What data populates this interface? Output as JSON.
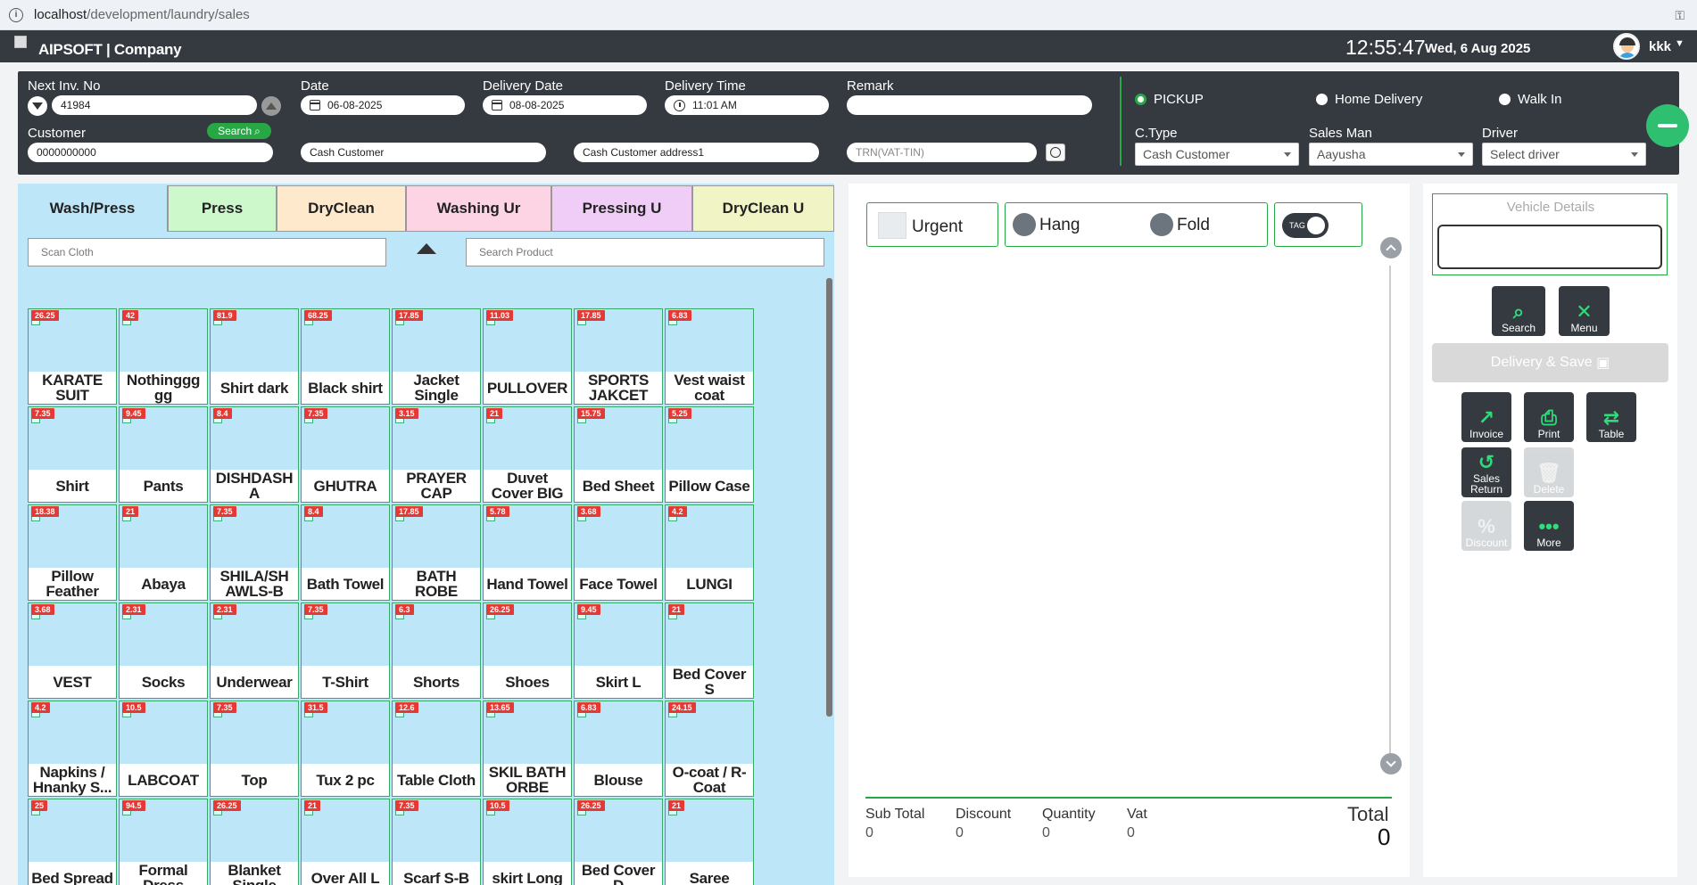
{
  "browser": {
    "url_host": "localhost",
    "url_path": "/development/laundry/sales"
  },
  "header": {
    "brand": "AIPSOFT | Company",
    "time": "12:55:47",
    "date": "Wed, 6 Aug 2025",
    "user": "kkk"
  },
  "form": {
    "next_inv_label": "Next Inv. No",
    "next_inv_value": "41984",
    "date_label": "Date",
    "date_value": "06-08-2025",
    "delivery_date_label": "Delivery Date",
    "delivery_date_value": "08-08-2025",
    "delivery_time_label": "Delivery Time",
    "delivery_time_value": "11:01 AM",
    "remark_label": "Remark",
    "remark_value": "",
    "customer_label": "Customer",
    "customer_search": "Search",
    "customer_phone": "0000000000",
    "customer_name": "Cash Customer",
    "customer_address": "Cash Customer address1",
    "trn_placeholder": "TRN(VAT-TIN)",
    "radio_pickup": "PICKUP",
    "radio_home": "Home Delivery",
    "radio_walkin": "Walk In",
    "ctype_label": "C.Type",
    "ctype_value": "Cash Customer",
    "salesman_label": "Sales Man",
    "salesman_value": "Aayusha",
    "driver_label": "Driver",
    "driver_value": "Select driver"
  },
  "tabs": [
    {
      "label": "Wash/Press",
      "color": "#bde6f8"
    },
    {
      "label": "Press",
      "color": "#cdf8cc"
    },
    {
      "label": "DryClean",
      "color": "#ffe9cc"
    },
    {
      "label": "Washing Ur",
      "color": "#fcd4e4"
    },
    {
      "label": "Pressing U",
      "color": "#efcdf7"
    },
    {
      "label": "DryClean U",
      "color": "#f1f4c4"
    }
  ],
  "search": {
    "scan_placeholder": "Scan Cloth",
    "product_placeholder": "Search Product"
  },
  "products": [
    {
      "price": "26.25",
      "name": "KARATE SUIT"
    },
    {
      "price": "42",
      "name": "Nothinggg gg"
    },
    {
      "price": "81.9",
      "name": "Shirt dark"
    },
    {
      "price": "68.25",
      "name": "Black shirt"
    },
    {
      "price": "17.85",
      "name": "Jacket Single"
    },
    {
      "price": "11.03",
      "name": "PULLOVER"
    },
    {
      "price": "17.85",
      "name": "SPORTS JAKCET"
    },
    {
      "price": "6.83",
      "name": "Vest waist coat"
    },
    {
      "price": "7.35",
      "name": "Shirt"
    },
    {
      "price": "9.45",
      "name": "Pants"
    },
    {
      "price": "8.4",
      "name": "DISHDASH A"
    },
    {
      "price": "7.35",
      "name": "GHUTRA"
    },
    {
      "price": "3.15",
      "name": "PRAYER CAP"
    },
    {
      "price": "21",
      "name": "Duvet Cover BIG"
    },
    {
      "price": "15.75",
      "name": "Bed Sheet"
    },
    {
      "price": "5.25",
      "name": "Pillow Case"
    },
    {
      "price": "18.38",
      "name": "Pillow Feather"
    },
    {
      "price": "21",
      "name": "Abaya"
    },
    {
      "price": "7.35",
      "name": "SHILA/SH AWLS-B"
    },
    {
      "price": "8.4",
      "name": "Bath Towel"
    },
    {
      "price": "17.85",
      "name": "BATH ROBE"
    },
    {
      "price": "5.78",
      "name": "Hand Towel"
    },
    {
      "price": "3.68",
      "name": "Face Towel"
    },
    {
      "price": "4.2",
      "name": "LUNGI"
    },
    {
      "price": "3.68",
      "name": "VEST"
    },
    {
      "price": "2.31",
      "name": "Socks"
    },
    {
      "price": "2.31",
      "name": "Underwear"
    },
    {
      "price": "7.35",
      "name": "T-Shirt"
    },
    {
      "price": "6.3",
      "name": "Shorts"
    },
    {
      "price": "26.25",
      "name": "Shoes"
    },
    {
      "price": "9.45",
      "name": "Skirt L"
    },
    {
      "price": "21",
      "name": "Bed Cover S"
    },
    {
      "price": "4.2",
      "name": "Napkins / Hnanky S..."
    },
    {
      "price": "10.5",
      "name": "LABCOAT"
    },
    {
      "price": "7.35",
      "name": "Top"
    },
    {
      "price": "31.5",
      "name": "Tux 2 pc"
    },
    {
      "price": "12.6",
      "name": "Table Cloth"
    },
    {
      "price": "13.65",
      "name": "SKIL BATH ORBE"
    },
    {
      "price": "6.83",
      "name": "Blouse"
    },
    {
      "price": "24.15",
      "name": "O-coat / R-Coat"
    },
    {
      "price": "25",
      "name": "Bed Spread"
    },
    {
      "price": "94.5",
      "name": "Formal Dress"
    },
    {
      "price": "26.25",
      "name": "Blanket Single"
    },
    {
      "price": "21",
      "name": "Over All L"
    },
    {
      "price": "7.35",
      "name": "Scarf S-B"
    },
    {
      "price": "10.5",
      "name": "skirt Long"
    },
    {
      "price": "26.25",
      "name": "Bed Cover D"
    },
    {
      "price": "21",
      "name": "Saree"
    }
  ],
  "options": {
    "urgent": "Urgent",
    "hang": "Hang",
    "fold": "Fold",
    "tag": "TAG"
  },
  "totals": {
    "sub_total_label": "Sub Total",
    "sub_total": "0",
    "discount_label": "Discount",
    "discount": "0",
    "quantity_label": "Quantity",
    "quantity": "0",
    "vat_label": "Vat",
    "vat": "0",
    "total_label": "Total",
    "total": "0"
  },
  "right": {
    "vehicle_label": "Vehicle Details",
    "search": "Search",
    "menu": "Menu",
    "delivery_save": "Delivery & Save",
    "invoice": "Invoice",
    "print": "Print",
    "table": "Table",
    "sales_return": "Sales Return",
    "delete": "Delete",
    "discount": "Discount",
    "more": "More"
  }
}
